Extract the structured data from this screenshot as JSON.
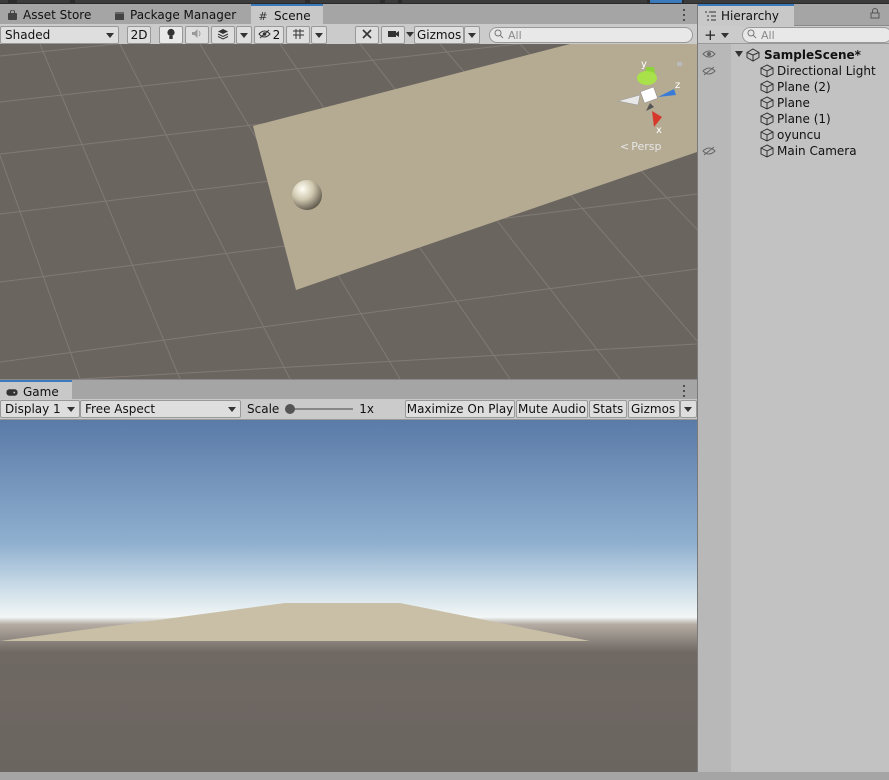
{
  "top_tabs": {
    "asset_store": "Asset Store",
    "package_manager": "Package Manager",
    "scene": "Scene"
  },
  "scene_toolbar": {
    "shading_mode": "Shaded",
    "mode_2d": "2D",
    "hidden_count": "2",
    "gizmos": "Gizmos",
    "search_placeholder": "All"
  },
  "scene_view": {
    "orientation_label": "Persp",
    "axis_x": "x",
    "axis_y": "y",
    "axis_z": "z"
  },
  "game_tab": {
    "label": "Game"
  },
  "game_toolbar": {
    "display": "Display 1",
    "aspect": "Free Aspect",
    "scale_label": "Scale",
    "scale_value": "1x",
    "scale_level": 0,
    "maximize_on_play": "Maximize On Play",
    "mute_audio": "Mute Audio",
    "stats": "Stats",
    "gizmos": "Gizmos"
  },
  "hierarchy": {
    "tab_label": "Hierarchy",
    "add_symbol": "+",
    "search_placeholder": "All",
    "scene_name": "SampleScene*",
    "items": [
      {
        "label": "Directional Light"
      },
      {
        "label": "Plane (2)"
      },
      {
        "label": "Plane"
      },
      {
        "label": "Plane (1)"
      },
      {
        "label": "oyuncu"
      },
      {
        "label": "Main Camera"
      }
    ]
  },
  "colors": {
    "accent_tab": "#3a79bb",
    "axis_x": "#d6382c",
    "axis_y": "#8fd33a",
    "axis_z": "#3a7bd6",
    "scene_ground": "#6b6560",
    "plane": "#b5ab93",
    "sky_top": "#5a7aa8",
    "sky_horizon": "#e6eef2"
  }
}
